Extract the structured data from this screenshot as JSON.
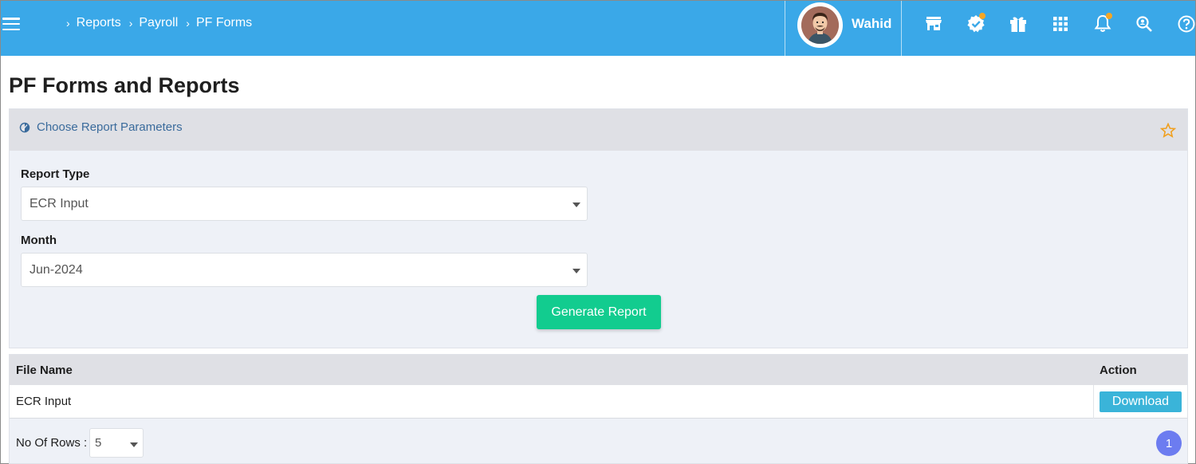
{
  "header": {
    "breadcrumb": [
      "Reports",
      "Payroll",
      "PF Forms"
    ],
    "user_name": "Wahid",
    "icons": [
      "store-icon",
      "verified-badge-icon",
      "gift-icon",
      "apps-grid-icon",
      "bell-icon",
      "search-people-icon",
      "help-icon"
    ],
    "accent_color": "#3aa8e8",
    "notification_dot_color": "#f5a623"
  },
  "page": {
    "title": "PF Forms and Reports"
  },
  "params": {
    "header_title": "Choose Report Parameters",
    "report_type_label": "Report Type",
    "report_type_value": "ECR Input",
    "month_label": "Month",
    "month_value": "Jun-2024",
    "generate_label": "Generate Report",
    "generate_color": "#12cc8f"
  },
  "results": {
    "columns": [
      "File Name",
      "Action"
    ],
    "rows": [
      {
        "file_name": "ECR Input",
        "action_label": "Download"
      }
    ],
    "rows_label": "No Of Rows :",
    "rows_value": "5",
    "current_page": "1"
  }
}
